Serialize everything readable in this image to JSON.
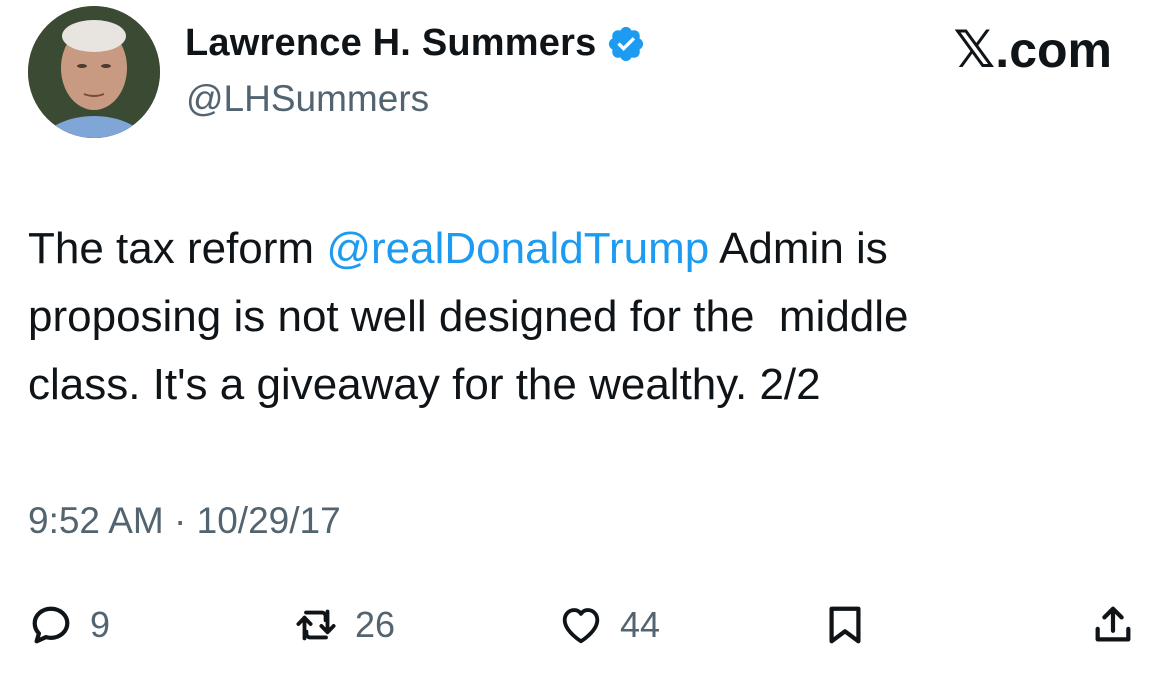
{
  "author": {
    "display_name": "Lawrence H. Summers",
    "handle": "@LHSummers",
    "verified": true
  },
  "brand": {
    "label": ".com",
    "logo_icon": "x-logo"
  },
  "tweet": {
    "text_before": "The tax reform ",
    "mention": "@realDonaldTrump",
    "text_after": " Admin is\nproposing is not well designed for the  middle\nclass. It's a giveaway for the wealthy. 2/2",
    "timestamp": "9:52 AM · 10/29/17"
  },
  "actions": {
    "reply": {
      "icon": "reply-icon",
      "count": "9"
    },
    "retweet": {
      "icon": "retweet-icon",
      "count": "26"
    },
    "like": {
      "icon": "heart-icon",
      "count": "44"
    },
    "bookmark": {
      "icon": "bookmark-icon"
    },
    "share": {
      "icon": "share-icon"
    }
  },
  "colors": {
    "link": "#1d9bf0",
    "secondary_text": "#536471",
    "primary_text": "#0f1419"
  }
}
